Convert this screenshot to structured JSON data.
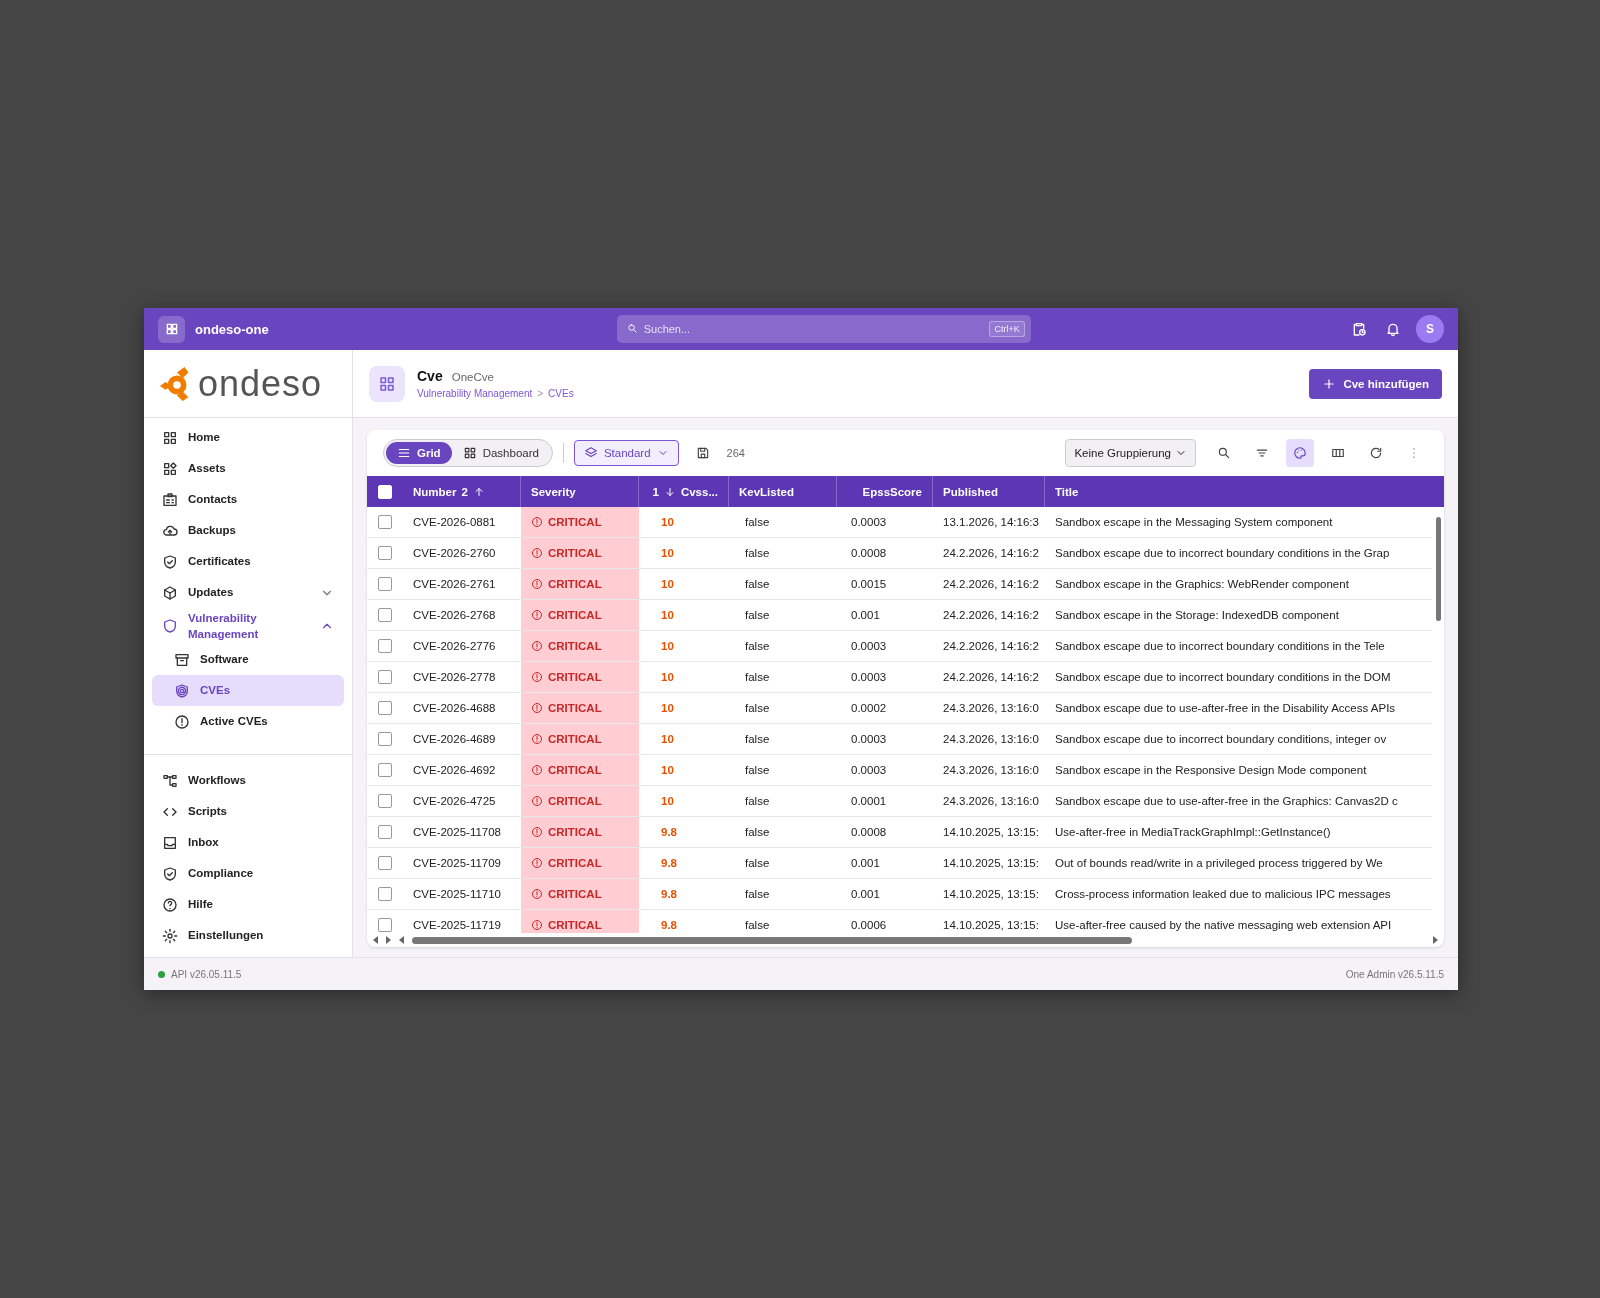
{
  "topbar": {
    "app_name": "ondeso-one",
    "search": {
      "placeholder": "Suchen...",
      "shortcut": "Ctrl+K"
    },
    "avatar": "S"
  },
  "logo": {
    "text": "ondeso"
  },
  "sidebar": {
    "items": [
      {
        "label": "Home",
        "selected": false
      },
      {
        "label": "Assets",
        "selected": false
      },
      {
        "label": "Contacts",
        "selected": false
      },
      {
        "label": "Backups",
        "selected": false
      },
      {
        "label": "Certificates",
        "selected": false
      },
      {
        "label": "Updates",
        "selected": false,
        "expanded": false
      },
      {
        "label": "Vulnerability Management",
        "selected": false,
        "expanded": true,
        "children": [
          {
            "label": "Software",
            "selected": false
          },
          {
            "label": "CVEs",
            "selected": true
          },
          {
            "label": "Active CVEs",
            "selected": false
          }
        ]
      }
    ],
    "bottom_items": [
      {
        "label": "Workflows",
        "selected": false
      },
      {
        "label": "Scripts",
        "selected": false
      },
      {
        "label": "Inbox",
        "selected": false
      },
      {
        "label": "Compliance",
        "selected": false
      },
      {
        "label": "Hilfe",
        "selected": false
      },
      {
        "label": "Einstellungen",
        "selected": false
      }
    ]
  },
  "header": {
    "title": "Cve",
    "subtitle": "OneCve",
    "breadcrumb": [
      "Vulnerability Management",
      "CVEs"
    ],
    "breadcrumb_separator": ">",
    "add_button": "Cve hinzufügen"
  },
  "toolbar": {
    "views": [
      {
        "label": "Grid",
        "selected": true
      },
      {
        "label": "Dashboard",
        "selected": false
      }
    ],
    "preset": "Standard",
    "count": "264",
    "grouping": "Keine Gruppierung",
    "tools": [
      {
        "selected": false
      },
      {
        "selected": false
      },
      {
        "selected": true
      },
      {
        "selected": false
      },
      {
        "selected": false
      },
      {
        "selected": false
      }
    ]
  },
  "table": {
    "select_all_checked": false,
    "columns": [
      {
        "label": "Number",
        "sort_order": "2",
        "sort_descending": false
      },
      {
        "label": "Severity"
      },
      {
        "label": "Cvss...",
        "sort_order": "1",
        "sort_descending": true
      },
      {
        "label": "KevListed"
      },
      {
        "label": "EpssScore"
      },
      {
        "label": "Published"
      },
      {
        "label": "Title"
      }
    ],
    "rows": [
      {
        "checked": false,
        "number": "CVE-2026-0881",
        "severity": "CRITICAL",
        "cvss": "10",
        "kev": "false",
        "epss": "0.0003",
        "published": "13.1.2026, 14:16:3",
        "title": "Sandbox escape in the Messaging System component"
      },
      {
        "checked": false,
        "number": "CVE-2026-2760",
        "severity": "CRITICAL",
        "cvss": "10",
        "kev": "false",
        "epss": "0.0008",
        "published": "24.2.2026, 14:16:2",
        "title": "Sandbox escape due to incorrect boundary conditions in the Grap"
      },
      {
        "checked": false,
        "number": "CVE-2026-2761",
        "severity": "CRITICAL",
        "cvss": "10",
        "kev": "false",
        "epss": "0.0015",
        "published": "24.2.2026, 14:16:2",
        "title": "Sandbox escape in the Graphics: WebRender component"
      },
      {
        "checked": false,
        "number": "CVE-2026-2768",
        "severity": "CRITICAL",
        "cvss": "10",
        "kev": "false",
        "epss": "0.001",
        "published": "24.2.2026, 14:16:2",
        "title": "Sandbox escape in the Storage: IndexedDB component"
      },
      {
        "checked": false,
        "number": "CVE-2026-2776",
        "severity": "CRITICAL",
        "cvss": "10",
        "kev": "false",
        "epss": "0.0003",
        "published": "24.2.2026, 14:16:2",
        "title": "Sandbox escape due to incorrect boundary conditions in the Tele"
      },
      {
        "checked": false,
        "number": "CVE-2026-2778",
        "severity": "CRITICAL",
        "cvss": "10",
        "kev": "false",
        "epss": "0.0003",
        "published": "24.2.2026, 14:16:2",
        "title": "Sandbox escape due to incorrect boundary conditions in the DOM"
      },
      {
        "checked": false,
        "number": "CVE-2026-4688",
        "severity": "CRITICAL",
        "cvss": "10",
        "kev": "false",
        "epss": "0.0002",
        "published": "24.3.2026, 13:16:0",
        "title": "Sandbox escape due to use-after-free in the Disability Access APIs"
      },
      {
        "checked": false,
        "number": "CVE-2026-4689",
        "severity": "CRITICAL",
        "cvss": "10",
        "kev": "false",
        "epss": "0.0003",
        "published": "24.3.2026, 13:16:0",
        "title": "Sandbox escape due to incorrect boundary conditions, integer ov"
      },
      {
        "checked": false,
        "number": "CVE-2026-4692",
        "severity": "CRITICAL",
        "cvss": "10",
        "kev": "false",
        "epss": "0.0003",
        "published": "24.3.2026, 13:16:0",
        "title": "Sandbox escape in the Responsive Design Mode component"
      },
      {
        "checked": false,
        "number": "CVE-2026-4725",
        "severity": "CRITICAL",
        "cvss": "10",
        "kev": "false",
        "epss": "0.0001",
        "published": "24.3.2026, 13:16:0",
        "title": "Sandbox escape due to use-after-free in the Graphics: Canvas2D c"
      },
      {
        "checked": false,
        "number": "CVE-2025-11708",
        "severity": "CRITICAL",
        "cvss": "9.8",
        "kev": "false",
        "epss": "0.0008",
        "published": "14.10.2025, 13:15:",
        "title": "Use-after-free in MediaTrackGraphImpl::GetInstance()"
      },
      {
        "checked": false,
        "number": "CVE-2025-11709",
        "severity": "CRITICAL",
        "cvss": "9.8",
        "kev": "false",
        "epss": "0.001",
        "published": "14.10.2025, 13:15:",
        "title": "Out of bounds read/write in a privileged process triggered by We"
      },
      {
        "checked": false,
        "number": "CVE-2025-11710",
        "severity": "CRITICAL",
        "cvss": "9.8",
        "kev": "false",
        "epss": "0.001",
        "published": "14.10.2025, 13:15:",
        "title": "Cross-process information leaked due to malicious IPC messages"
      },
      {
        "checked": false,
        "number": "CVE-2025-11719",
        "severity": "CRITICAL",
        "cvss": "9.8",
        "kev": "false",
        "epss": "0.0006",
        "published": "14.10.2025, 13:15:",
        "title": "Use-after-free caused by the native messaging web extension API"
      }
    ]
  },
  "footer": {
    "api_version": "API v26.05.11.5",
    "api_online": true,
    "app_version": "One Admin v26.5.11.5"
  }
}
